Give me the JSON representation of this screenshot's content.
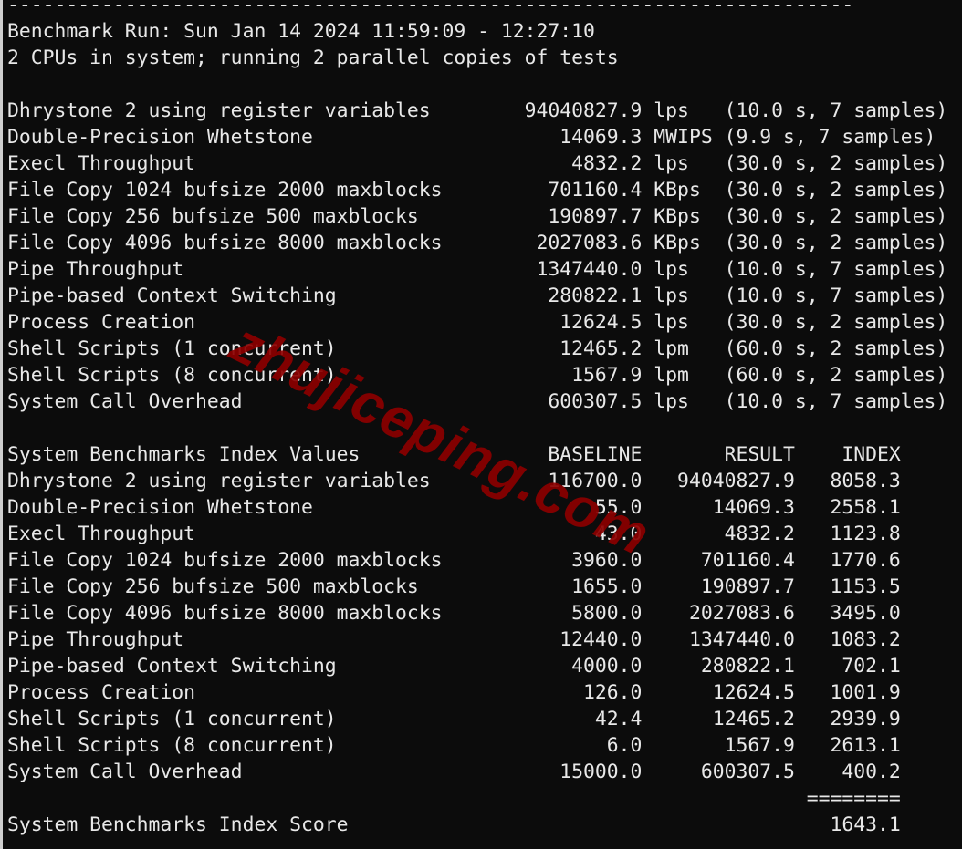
{
  "terminal": {
    "separator": "------------------------------------------------------------------------",
    "run_line": "Benchmark Run: Sun Jan 14 2024 11:59:09 - 12:27:10",
    "cpu_line": "2 CPUs in system; running 2 parallel copies of tests"
  },
  "results": [
    {
      "name": "Dhrystone 2 using register variables",
      "value": "94040827.9",
      "unit": "lps",
      "detail": "(10.0 s, 7 samples)"
    },
    {
      "name": "Double-Precision Whetstone",
      "value": "14069.3",
      "unit": "MWIPS",
      "detail": "(9.9 s, 7 samples)"
    },
    {
      "name": "Execl Throughput",
      "value": "4832.2",
      "unit": "lps",
      "detail": "(30.0 s, 2 samples)"
    },
    {
      "name": "File Copy 1024 bufsize 2000 maxblocks",
      "value": "701160.4",
      "unit": "KBps",
      "detail": "(30.0 s, 2 samples)"
    },
    {
      "name": "File Copy 256 bufsize 500 maxblocks",
      "value": "190897.7",
      "unit": "KBps",
      "detail": "(30.0 s, 2 samples)"
    },
    {
      "name": "File Copy 4096 bufsize 8000 maxblocks",
      "value": "2027083.6",
      "unit": "KBps",
      "detail": "(30.0 s, 2 samples)"
    },
    {
      "name": "Pipe Throughput",
      "value": "1347440.0",
      "unit": "lps",
      "detail": "(10.0 s, 7 samples)"
    },
    {
      "name": "Pipe-based Context Switching",
      "value": "280822.1",
      "unit": "lps",
      "detail": "(10.0 s, 7 samples)"
    },
    {
      "name": "Process Creation",
      "value": "12624.5",
      "unit": "lps",
      "detail": "(30.0 s, 2 samples)"
    },
    {
      "name": "Shell Scripts (1 concurrent)",
      "value": "12465.2",
      "unit": "lpm",
      "detail": "(60.0 s, 2 samples)"
    },
    {
      "name": "Shell Scripts (8 concurrent)",
      "value": "1567.9",
      "unit": "lpm",
      "detail": "(60.0 s, 2 samples)"
    },
    {
      "name": "System Call Overhead",
      "value": "600307.5",
      "unit": "lps",
      "detail": "(10.0 s, 7 samples)"
    }
  ],
  "index_table": {
    "title": "System Benchmarks Index Values",
    "headers": [
      "BASELINE",
      "RESULT",
      "INDEX"
    ],
    "rows": [
      {
        "name": "Dhrystone 2 using register variables",
        "baseline": "116700.0",
        "result": "94040827.9",
        "index": "8058.3"
      },
      {
        "name": "Double-Precision Whetstone",
        "baseline": "55.0",
        "result": "14069.3",
        "index": "2558.1"
      },
      {
        "name": "Execl Throughput",
        "baseline": "43.0",
        "result": "4832.2",
        "index": "1123.8"
      },
      {
        "name": "File Copy 1024 bufsize 2000 maxblocks",
        "baseline": "3960.0",
        "result": "701160.4",
        "index": "1770.6"
      },
      {
        "name": "File Copy 256 bufsize 500 maxblocks",
        "baseline": "1655.0",
        "result": "190897.7",
        "index": "1153.5"
      },
      {
        "name": "File Copy 4096 bufsize 8000 maxblocks",
        "baseline": "5800.0",
        "result": "2027083.6",
        "index": "3495.0"
      },
      {
        "name": "Pipe Throughput",
        "baseline": "12440.0",
        "result": "1347440.0",
        "index": "1083.2"
      },
      {
        "name": "Pipe-based Context Switching",
        "baseline": "4000.0",
        "result": "280822.1",
        "index": "702.1"
      },
      {
        "name": "Process Creation",
        "baseline": "126.0",
        "result": "12624.5",
        "index": "1001.9"
      },
      {
        "name": "Shell Scripts (1 concurrent)",
        "baseline": "42.4",
        "result": "12465.2",
        "index": "2939.9"
      },
      {
        "name": "Shell Scripts (8 concurrent)",
        "baseline": "6.0",
        "result": "1567.9",
        "index": "2613.1"
      },
      {
        "name": "System Call Overhead",
        "baseline": "15000.0",
        "result": "600307.5",
        "index": "400.2"
      }
    ],
    "rule": "========",
    "score_label": "System Benchmarks Index Score",
    "score": "1643.1"
  },
  "watermark": {
    "text": "zhujiceping.com",
    "color": "#8b0000"
  }
}
